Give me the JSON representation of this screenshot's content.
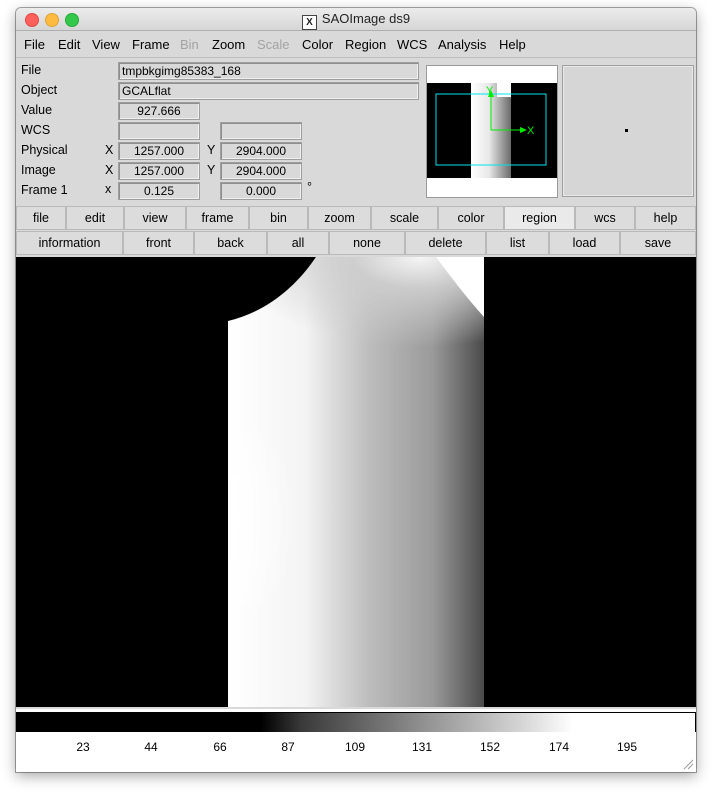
{
  "window": {
    "title": "SAOImage ds9"
  },
  "menubar": {
    "items": [
      {
        "label": "File",
        "enabled": true
      },
      {
        "label": "Edit",
        "enabled": true
      },
      {
        "label": "View",
        "enabled": true
      },
      {
        "label": "Frame",
        "enabled": true
      },
      {
        "label": "Bin",
        "enabled": false
      },
      {
        "label": "Zoom",
        "enabled": true
      },
      {
        "label": "Scale",
        "enabled": false
      },
      {
        "label": "Color",
        "enabled": true
      },
      {
        "label": "Region",
        "enabled": true
      },
      {
        "label": "WCS",
        "enabled": true
      },
      {
        "label": "Analysis",
        "enabled": true
      },
      {
        "label": "Help",
        "enabled": true
      }
    ]
  },
  "info": {
    "file_label": "File",
    "file_value": "tmpbkgimg85383_168",
    "object_label": "Object",
    "object_value": "GCALflat",
    "value_label": "Value",
    "value_value": "927.666",
    "wcs_label": "WCS",
    "wcs_x": "",
    "wcs_y": "",
    "physical_label": "Physical",
    "physical_x_axis": "X",
    "physical_x": "1257.000",
    "physical_y_axis": "Y",
    "physical_y": "2904.000",
    "image_label": "Image",
    "image_x_axis": "X",
    "image_x": "1257.000",
    "image_y_axis": "Y",
    "image_y": "2904.000",
    "frame_label": "Frame 1",
    "frame_mult": "x",
    "frame_zoom": "0.125",
    "frame_angle": "0.000",
    "degree": "°"
  },
  "panner": {
    "x_axis": "X",
    "y_axis": "Y"
  },
  "buttonbar": {
    "row1": [
      "file",
      "edit",
      "view",
      "frame",
      "bin",
      "zoom",
      "scale",
      "color",
      "region",
      "wcs",
      "help"
    ],
    "row1_active": "region",
    "row2": [
      "information",
      "front",
      "back",
      "all",
      "none",
      "delete",
      "list",
      "load",
      "save"
    ]
  },
  "colorbar": {
    "ticks": [
      "23",
      "44",
      "66",
      "87",
      "109",
      "131",
      "152",
      "174",
      "195"
    ]
  },
  "colors": {
    "window_bg": "#d9d9d9",
    "panner_box": "#00e5ee",
    "panner_axes": "#00ee00"
  }
}
